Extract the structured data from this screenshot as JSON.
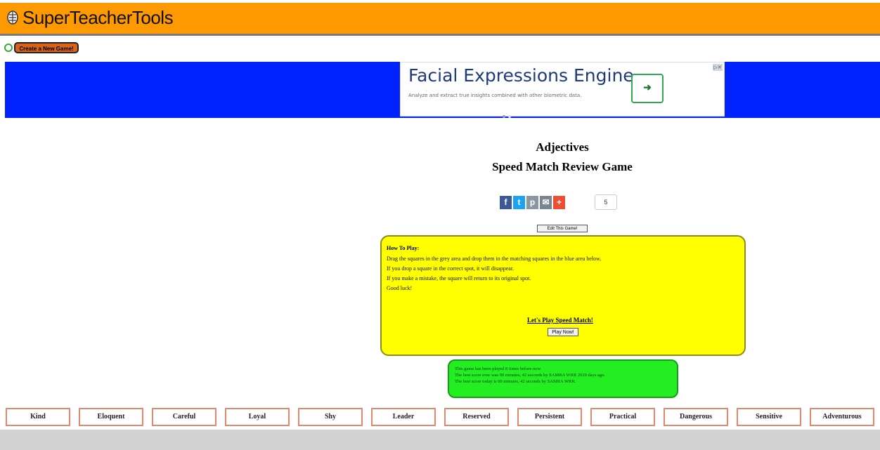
{
  "header": {
    "logo_text": "SuperTeacherTools",
    "create_button": "Create a New Game!"
  },
  "ad": {
    "title": "Facial Expressions Engine",
    "description": "Analyze and extract true insights combined with other biometric data.",
    "arrow_icon": "arrow-right-icon",
    "close_icon": "ad-choices-icon"
  },
  "game": {
    "title": "Adjectives",
    "subtitle": "Speed Match Review Game",
    "share_count": "5",
    "edit_button": "Edit This Game!"
  },
  "share_icons": [
    "facebook-icon",
    "twitter-icon",
    "pinterest-icon",
    "email-icon",
    "plus-icon"
  ],
  "how_to_play": {
    "heading": "How To Play:",
    "lines": [
      "Drag the squares in the grey area and drop them in the matching squares in the blue area below.",
      "If you drop a square in the correct spot, it will disappear.",
      "If you make a mistake, the square will return to its original spot.",
      "Good luck!"
    ],
    "link": "Let's Play Speed Match!",
    "play_button": "Play Now!"
  },
  "stats": {
    "lines": [
      "This game has been played 8 times before now.",
      "The best score ever was 00 minutes, 42 seconds by SAMRA WRR 2020 days ago.",
      "The best score today is 00 minutes, 42 seconds by SAMRA WRR."
    ]
  },
  "words": [
    "Kind",
    "Eloquent",
    "Careful",
    "Loyal",
    "Shy",
    "Leader",
    "Reserved",
    "Persistent",
    "Practical",
    "Dangerous",
    "Sensitive",
    "Adventurous"
  ],
  "colors": {
    "header": "#ff9900",
    "ad_band": "#0022ff",
    "instructions": "#ffff00",
    "stats": "#22ee22",
    "word_border": "#e08870",
    "drag_area": "#d3d3d3"
  }
}
